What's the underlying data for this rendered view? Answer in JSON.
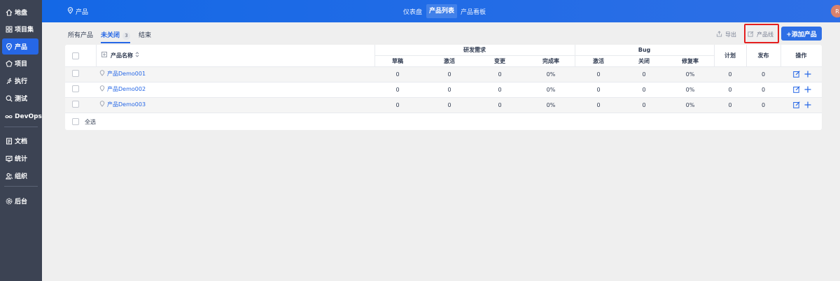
{
  "sidebar": {
    "items": [
      {
        "label": "地盘",
        "icon": "home-icon"
      },
      {
        "label": "项目集",
        "icon": "grid-icon"
      },
      {
        "label": "产品",
        "icon": "product-pin-icon",
        "active": true
      },
      {
        "label": "项目",
        "icon": "project-icon"
      },
      {
        "label": "执行",
        "icon": "run-icon"
      },
      {
        "label": "测试",
        "icon": "test-search-icon"
      },
      {
        "label": "DevOps",
        "icon": "infinity-icon"
      },
      {
        "label": "文档",
        "icon": "doc-icon"
      },
      {
        "label": "统计",
        "icon": "stats-icon"
      },
      {
        "label": "组织",
        "icon": "org-icon"
      },
      {
        "label": "后台",
        "icon": "gear-icon"
      }
    ]
  },
  "header": {
    "title": "产品",
    "tabs": [
      {
        "label": "仪表盘",
        "active": false
      },
      {
        "label": "产品列表",
        "active": true
      },
      {
        "label": "产品看板",
        "active": false
      }
    ],
    "avatar_initial": "R"
  },
  "toolbar": {
    "filters": [
      {
        "label": "所有产品",
        "active": false
      },
      {
        "label": "未关闭",
        "active": true,
        "count": "3"
      },
      {
        "label": "结束",
        "active": false
      }
    ],
    "export_label": "导出",
    "product_line_label": "产品线",
    "add_product_label": "+添加产品"
  },
  "table": {
    "name_header": "产品名称",
    "group_requirements": "研发需求",
    "group_bug": "Bug",
    "plan_header": "计划",
    "release_header": "发布",
    "action_header": "操作",
    "req_cols": [
      "草稿",
      "激活",
      "变更",
      "完成率"
    ],
    "bug_cols": [
      "激活",
      "关闭",
      "修复率"
    ],
    "rows": [
      {
        "name": "产品Demo001",
        "draft": "0",
        "active": "0",
        "changed": "0",
        "req_rate": "0%",
        "bug_active": "0",
        "bug_closed": "0",
        "fix_rate": "0%",
        "plan": "0",
        "release": "0"
      },
      {
        "name": "产品Demo002",
        "draft": "0",
        "active": "0",
        "changed": "0",
        "req_rate": "0%",
        "bug_active": "0",
        "bug_closed": "0",
        "fix_rate": "0%",
        "plan": "0",
        "release": "0"
      },
      {
        "name": "产品Demo003",
        "draft": "0",
        "active": "0",
        "changed": "0",
        "req_rate": "0%",
        "bug_active": "0",
        "bug_closed": "0",
        "fix_rate": "0%",
        "plan": "0",
        "release": "0"
      }
    ],
    "select_all_label": "全选"
  },
  "colors": {
    "accent": "#2667e6",
    "sidebar_bg": "#3c4353",
    "highlight": "#e41f1f"
  }
}
